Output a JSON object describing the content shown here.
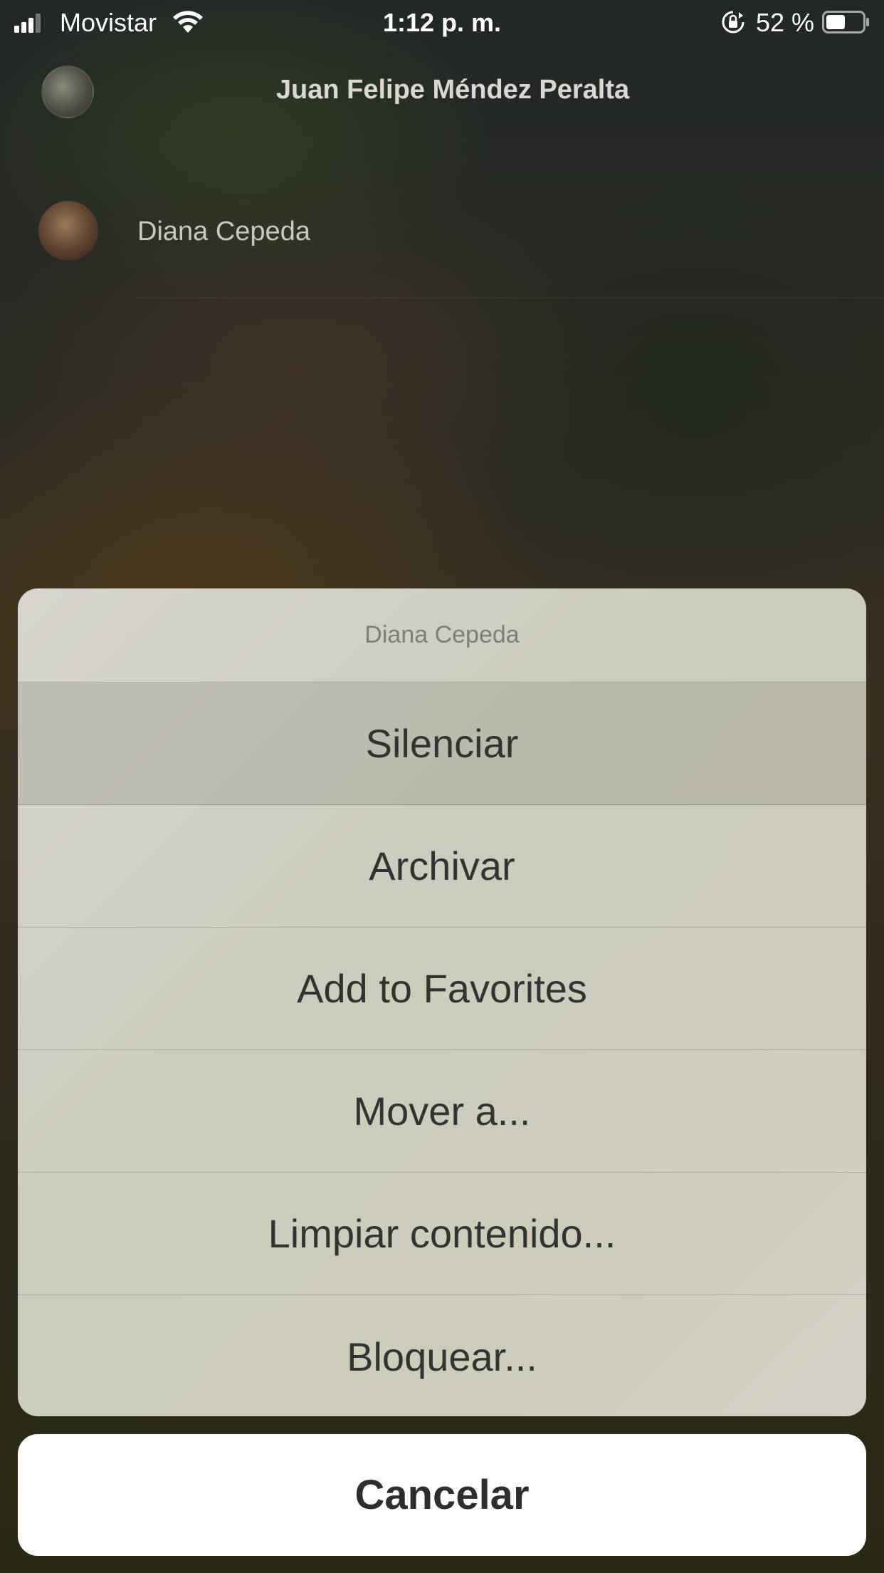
{
  "status_bar": {
    "carrier": "Movistar",
    "time": "1:12 p. m.",
    "battery_percent": "52 %",
    "battery_level": 0.52,
    "signal_icon": "cellular-signal-icon",
    "wifi_icon": "wifi-icon",
    "orientation_lock_icon": "orientation-lock-icon",
    "battery_icon": "battery-icon"
  },
  "header": {
    "title": "Juan Felipe Méndez Peralta"
  },
  "chat_row": {
    "name": "Diana Cepeda"
  },
  "action_sheet": {
    "title": "Diana Cepeda",
    "items": [
      {
        "label": "Silenciar",
        "highlighted": true
      },
      {
        "label": "Archivar"
      },
      {
        "label": "Add to Favorites"
      },
      {
        "label": "Mover a..."
      },
      {
        "label": "Limpiar contenido..."
      },
      {
        "label": "Bloquear..."
      }
    ],
    "cancel_label": "Cancelar"
  },
  "colors": {
    "sheet_text": "#33332f",
    "sheet_title_text": "#7e7e76",
    "cancel_background": "#ffffff"
  }
}
